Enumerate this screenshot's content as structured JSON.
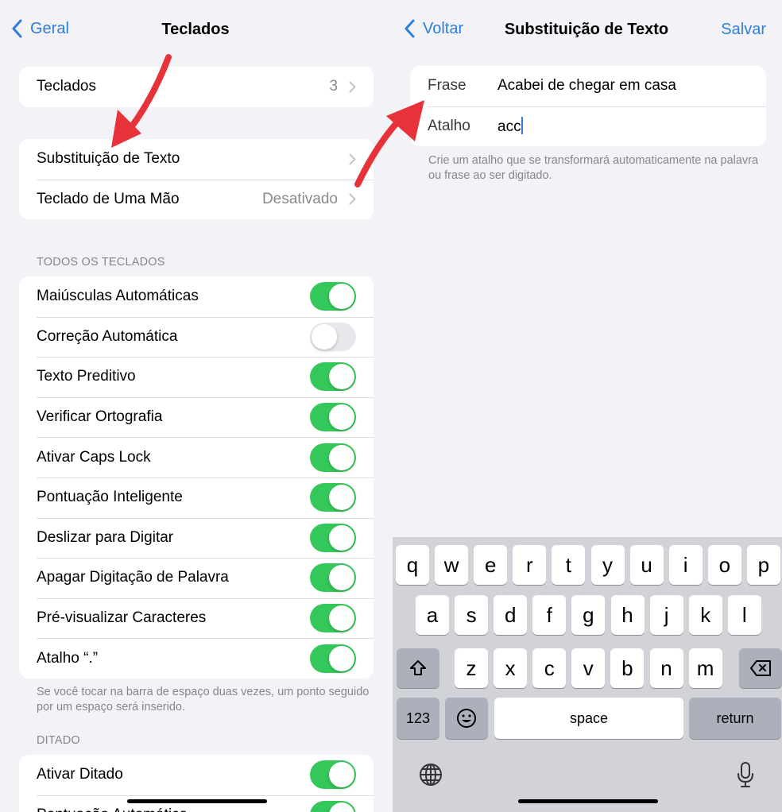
{
  "left": {
    "back_label": "Geral",
    "title": "Teclados",
    "keyboards_row": {
      "label": "Teclados",
      "value": "3"
    },
    "group2": [
      {
        "label": "Substituição de Texto",
        "value": ""
      },
      {
        "label": "Teclado de Uma Mão",
        "value": "Desativado"
      }
    ],
    "all_keyboards_header": "TODOS OS TECLADOS",
    "toggles": [
      {
        "label": "Maiúsculas Automáticas",
        "on": true
      },
      {
        "label": "Correção Automática",
        "on": false
      },
      {
        "label": "Texto Preditivo",
        "on": true
      },
      {
        "label": "Verificar Ortografia",
        "on": true
      },
      {
        "label": "Ativar Caps Lock",
        "on": true
      },
      {
        "label": "Pontuação Inteligente",
        "on": true
      },
      {
        "label": "Deslizar para Digitar",
        "on": true
      },
      {
        "label": "Apagar Digitação de Palavra",
        "on": true
      },
      {
        "label": "Pré-visualizar Caracteres",
        "on": true
      },
      {
        "label": "Atalho “.”",
        "on": true
      }
    ],
    "toggles_footer": "Se você tocar na barra de espaço duas vezes, um ponto seguido por um espaço será inserido.",
    "dictation_header": "DITADO",
    "dictation_toggles": [
      {
        "label": "Ativar Ditado",
        "on": true
      },
      {
        "label": "Pontuação Automática",
        "on": true
      }
    ]
  },
  "right": {
    "back_label": "Voltar",
    "title": "Substituição de Texto",
    "save_label": "Salvar",
    "phrase_label": "Frase",
    "phrase_value": "Acabei de chegar em casa",
    "shortcut_label": "Atalho",
    "shortcut_value": "acc",
    "hint": "Crie um atalho que se transformará automaticamente na palavra ou frase ao ser digitado."
  },
  "keyboard": {
    "row1": [
      "q",
      "w",
      "e",
      "r",
      "t",
      "y",
      "u",
      "i",
      "o",
      "p"
    ],
    "row2": [
      "a",
      "s",
      "d",
      "f",
      "g",
      "h",
      "j",
      "k",
      "l"
    ],
    "row3": [
      "z",
      "x",
      "c",
      "v",
      "b",
      "n",
      "m"
    ],
    "numbers_label": "123",
    "space_label": "space",
    "return_label": "return"
  },
  "colors": {
    "accent": "#2f7fd6",
    "toggle_on": "#34c759",
    "arrow": "#e8323a"
  }
}
